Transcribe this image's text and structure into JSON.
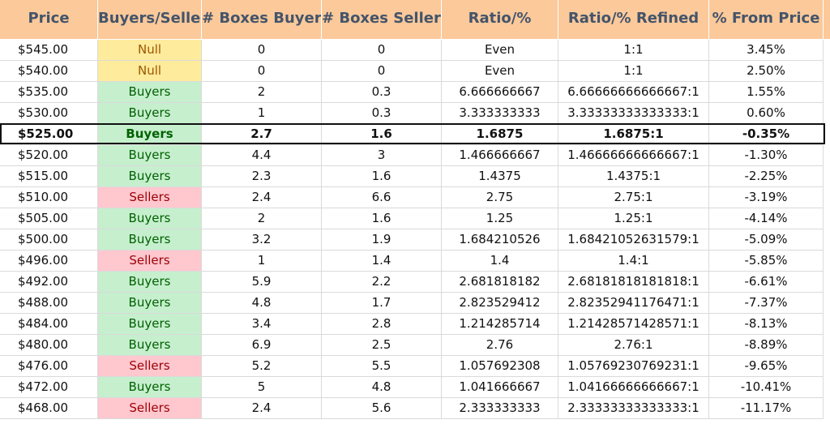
{
  "colors": {
    "header_bg": "#fbc99a",
    "header_text": "#44546a",
    "buyers_bg": "#c6efce",
    "buyers_text": "#006100",
    "sellers_bg": "#ffc7ce",
    "sellers_text": "#9c0006",
    "null_bg": "#ffeb9c",
    "null_text": "#9c5700"
  },
  "table": {
    "headers": [
      "Price",
      "Buyers/Sellers",
      "# Boxes Buyers",
      "# Boxes Sellers",
      "Ratio/%",
      "Ratio/% Refined",
      "% From Price"
    ],
    "highlight_row": 4,
    "rows": [
      [
        "$545.00",
        "Null",
        "0",
        "0",
        "Even",
        "1:1",
        "3.45%"
      ],
      [
        "$540.00",
        "Null",
        "0",
        "0",
        "Even",
        "1:1",
        "2.50%"
      ],
      [
        "$535.00",
        "Buyers",
        "2",
        "0.3",
        "6.666666667",
        "6.66666666666667:1",
        "1.55%"
      ],
      [
        "$530.00",
        "Buyers",
        "1",
        "0.3",
        "3.333333333",
        "3.33333333333333:1",
        "0.60%"
      ],
      [
        "$525.00",
        "Buyers",
        "2.7",
        "1.6",
        "1.6875",
        "1.6875:1",
        "-0.35%"
      ],
      [
        "$520.00",
        "Buyers",
        "4.4",
        "3",
        "1.466666667",
        "1.46666666666667:1",
        "-1.30%"
      ],
      [
        "$515.00",
        "Buyers",
        "2.3",
        "1.6",
        "1.4375",
        "1.4375:1",
        "-2.25%"
      ],
      [
        "$510.00",
        "Sellers",
        "2.4",
        "6.6",
        "2.75",
        "2.75:1",
        "-3.19%"
      ],
      [
        "$505.00",
        "Buyers",
        "2",
        "1.6",
        "1.25",
        "1.25:1",
        "-4.14%"
      ],
      [
        "$500.00",
        "Buyers",
        "3.2",
        "1.9",
        "1.684210526",
        "1.68421052631579:1",
        "-5.09%"
      ],
      [
        "$496.00",
        "Sellers",
        "1",
        "1.4",
        "1.4",
        "1.4:1",
        "-5.85%"
      ],
      [
        "$492.00",
        "Buyers",
        "5.9",
        "2.2",
        "2.681818182",
        "2.68181818181818:1",
        "-6.61%"
      ],
      [
        "$488.00",
        "Buyers",
        "4.8",
        "1.7",
        "2.823529412",
        "2.82352941176471:1",
        "-7.37%"
      ],
      [
        "$484.00",
        "Buyers",
        "3.4",
        "2.8",
        "1.214285714",
        "1.21428571428571:1",
        "-8.13%"
      ],
      [
        "$480.00",
        "Buyers",
        "6.9",
        "2.5",
        "2.76",
        "2.76:1",
        "-8.89%"
      ],
      [
        "$476.00",
        "Sellers",
        "5.2",
        "5.5",
        "1.057692308",
        "1.05769230769231:1",
        "-9.65%"
      ],
      [
        "$472.00",
        "Buyers",
        "5",
        "4.8",
        "1.041666667",
        "1.04166666666667:1",
        "-10.41%"
      ],
      [
        "$468.00",
        "Sellers",
        "2.4",
        "5.6",
        "2.333333333",
        "2.33333333333333:1",
        "-11.17%"
      ]
    ]
  }
}
